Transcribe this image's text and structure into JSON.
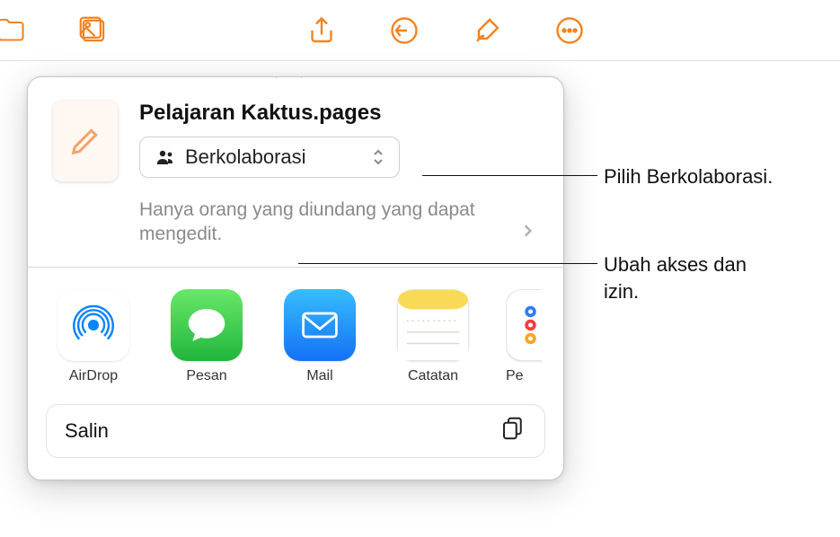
{
  "document": {
    "title": "Pelajaran Kaktus.pages"
  },
  "collaborate": {
    "label": "Berkolaborasi"
  },
  "permission": {
    "text": "Hanya orang yang diundang yang dapat mengedit."
  },
  "share_targets": [
    {
      "label": "AirDrop"
    },
    {
      "label": "Pesan"
    },
    {
      "label": "Mail"
    },
    {
      "label": "Catatan"
    },
    {
      "label": "Pe"
    }
  ],
  "actions": {
    "copy": "Salin"
  },
  "callouts": {
    "collab": "Pilih Berkolaborasi.",
    "perm": "Ubah akses dan izin."
  }
}
